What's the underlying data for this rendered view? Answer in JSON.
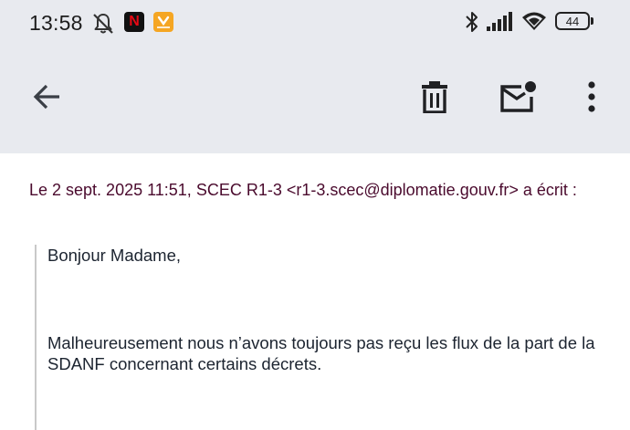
{
  "status_bar": {
    "time": "13:58",
    "battery": "44",
    "icons": [
      "notifications-off-icon",
      "netflix-app-icon",
      "shopping-app-icon",
      "bluetooth-icon",
      "cell-signal-icon",
      "wifi-icon",
      "battery-icon"
    ],
    "netflix_letter": "N"
  },
  "app_bar": {
    "icons": [
      "back-arrow-icon",
      "delete-icon",
      "mark-unread-icon",
      "more-vert-icon"
    ]
  },
  "message": {
    "header": "Le 2 sept. 2025 11:51, SCEC R1-3 <r1-3.scec@diplomatie.gouv.fr> a écrit :",
    "greeting": "Bonjour Madame,",
    "paragraph": "Malheureusement nous n’avons toujours pas reçu les flux de la part de la SDANF concernant certains décrets."
  },
  "colors": {
    "top_bg": "#e8eaef",
    "header_text": "#4a0a2d",
    "body_text": "#1c2430",
    "quote_bar": "#c9c9c9"
  }
}
